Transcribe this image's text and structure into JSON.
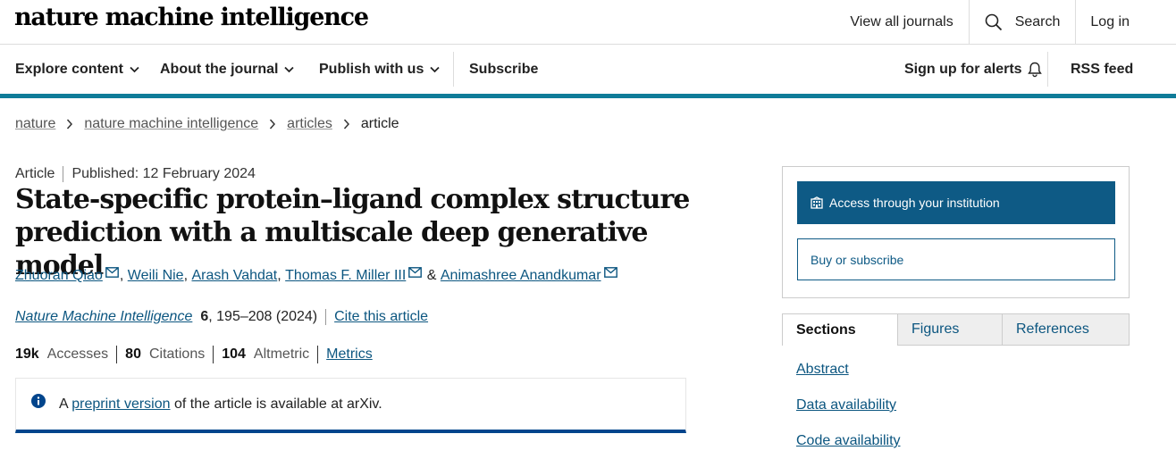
{
  "header": {
    "logo": "nature machine intelligence",
    "view_all_journals": "View all journals",
    "search_label": "Search",
    "login_label": "Log in"
  },
  "nav": {
    "explore": "Explore content",
    "about": "About the journal",
    "publish": "Publish with us",
    "subscribe": "Subscribe",
    "alerts": "Sign up for alerts",
    "rss": "RSS feed",
    "accent_color": "#0f7c99"
  },
  "breadcrumb": [
    "nature",
    "nature machine intelligence",
    "articles",
    "article"
  ],
  "article": {
    "type": "Article",
    "published": "Published: 12 February 2024",
    "title": "State-specific protein–ligand complex structure prediction with a multiscale deep generative model",
    "authors": [
      "Zhuoran Qiao",
      "Weili Nie",
      "Arash Vahdat",
      "Thomas F. Miller III",
      "Animashree Anandkumar"
    ],
    "author_sep": ",",
    "author_amp": "&",
    "journal": "Nature Machine Intelligence",
    "volume": "6",
    "pages": ", 195–208 (2024)",
    "cite_label": "Cite this article",
    "metrics": [
      {
        "value": "19k",
        "label": "Accesses"
      },
      {
        "value": "80",
        "label": "Citations"
      },
      {
        "value": "104",
        "label": "Altmetric"
      }
    ],
    "metrics_link": "Metrics"
  },
  "notice": {
    "prefix": "A",
    "link": "preprint version",
    "suffix": "of the article is available at arXiv."
  },
  "sidebar": {
    "access_label": "Access through your institution",
    "buy_label": "Buy or subscribe",
    "tabs": [
      "Sections",
      "Figures",
      "References"
    ],
    "sections": [
      "Abstract",
      "Data availability",
      "Code availability"
    ],
    "primary_color": "#0e5a85"
  }
}
